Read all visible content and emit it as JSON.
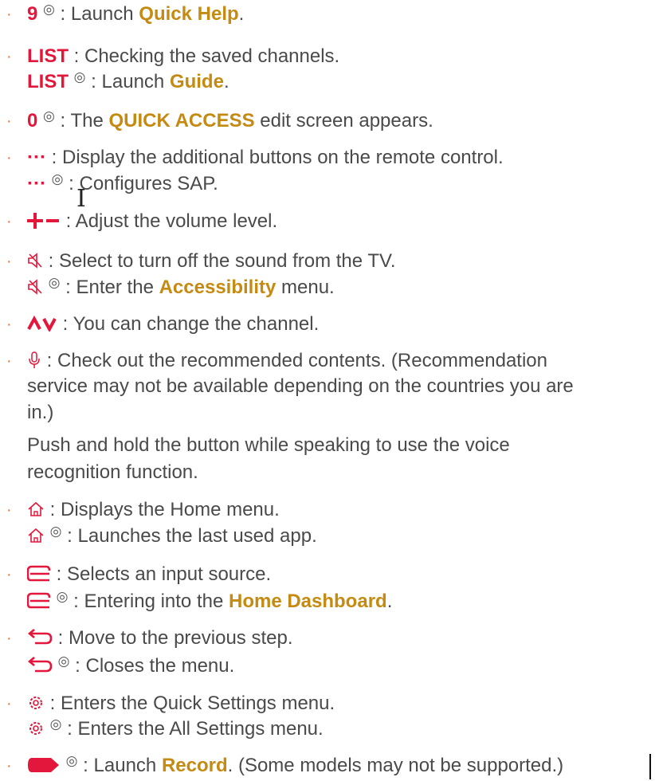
{
  "bullet": "·",
  "ok": "◎",
  "items": {
    "b9": {
      "key": "9",
      "text1": " : Launch ",
      "hl": "Quick Help",
      "text2": "."
    },
    "list": {
      "key": "LIST",
      "text": " : Checking the saved channels."
    },
    "list_ok": {
      "key": "LIST",
      "text1": " : Launch ",
      "hl": "Guide",
      "text2": "."
    },
    "b0": {
      "key": "0",
      "text1": " : The ",
      "hl": "QUICK ACCESS",
      "text2": " edit screen appears."
    },
    "more": {
      "key": "···",
      "text": " : Display the additional buttons on the remote control."
    },
    "more_ok": {
      "key": "···",
      "text": " : Configures SAP."
    },
    "vol": {
      "text": " : Adjust the volume level."
    },
    "mute": {
      "text": " : Select to turn off the sound from the TV."
    },
    "mute_ok": {
      "text1": " : Enter the ",
      "hl": "Accessibility",
      "text2": " menu."
    },
    "ch": {
      "text": " : You can change the channel."
    },
    "mic": {
      "l1": " : Check out the recommended contents. (Recommendation",
      "l2": "service may not be available depending on the countries you are",
      "l3": "in.)",
      "l4": "Push and hold the button while speaking to use the voice",
      "l5": "recognition function."
    },
    "home": {
      "text": " : Displays the Home menu."
    },
    "home_ok": {
      "text": " : Launches the last used app."
    },
    "input": {
      "text": " : Selects an input source."
    },
    "input_ok": {
      "text1": " : Entering into the ",
      "hl": "Home Dashboard",
      "text2": "."
    },
    "back": {
      "text": " : Move to the previous step."
    },
    "back_ok": {
      "text": " : Closes the menu."
    },
    "settings": {
      "text": " : Enters the Quick Settings menu."
    },
    "settings_ok": {
      "text": " : Enters the All Settings menu."
    },
    "rec": {
      "text1": " : Launch ",
      "hl": "Record",
      "text2": ". (Some models may not be supported.)"
    }
  },
  "icons": {
    "volume": "plus-minus-icon",
    "mute": "mute-icon",
    "channel": "channel-up-down-icon",
    "mic": "microphone-icon",
    "home": "home-icon",
    "input": "input-icon",
    "back": "back-icon",
    "settings": "settings-gear-icon",
    "record": "record-icon"
  },
  "colors": {
    "key": "#e3173b",
    "highlight": "#c58a12",
    "text": "#4a4a4a",
    "bullet": "#e8732a"
  }
}
